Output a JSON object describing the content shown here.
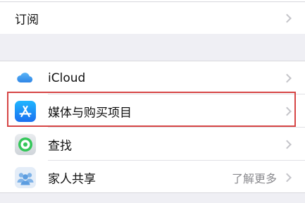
{
  "top_group": {
    "subscriptions_label": "订阅"
  },
  "main_group": {
    "items": [
      {
        "label": "iCloud",
        "icon": "icloud-icon",
        "detail": ""
      },
      {
        "label": "媒体与购买项目",
        "icon": "app-store-icon",
        "detail": ""
      },
      {
        "label": "查找",
        "icon": "find-my-icon",
        "detail": ""
      },
      {
        "label": "家人共享",
        "icon": "family-sharing-icon",
        "detail": "了解更多"
      }
    ]
  },
  "colors": {
    "highlight": "#d64545",
    "app_store_blue": "#1a8cf0",
    "find_my_green": "#34c759"
  }
}
